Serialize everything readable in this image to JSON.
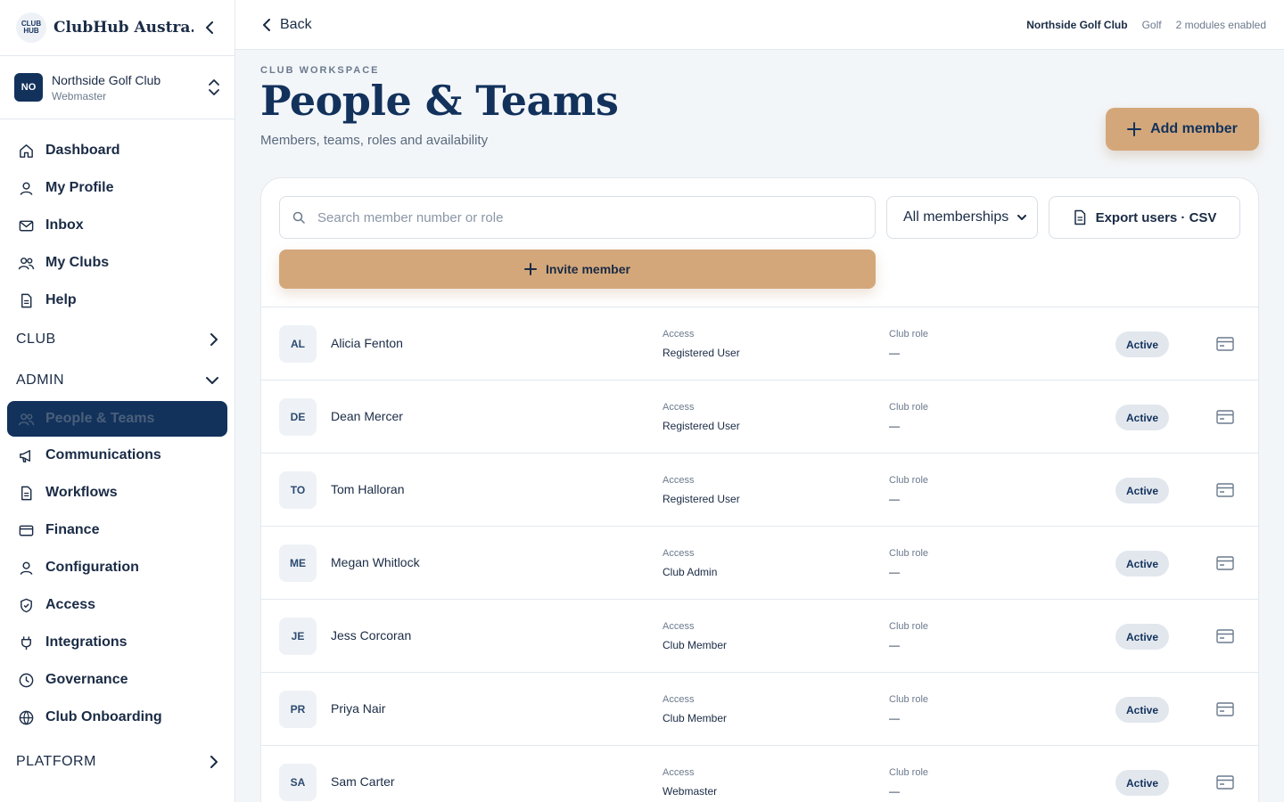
{
  "brand": {
    "title": "ClubHub Austra...",
    "logo_text": "CLUB HUB"
  },
  "club": {
    "badge": "NO",
    "name": "Northside Golf Club",
    "role": "Webmaster"
  },
  "nav": {
    "items": [
      {
        "label": "Dashboard",
        "icon": "home-icon"
      },
      {
        "label": "My Profile",
        "icon": "user-icon"
      },
      {
        "label": "Inbox",
        "icon": "mail-icon"
      },
      {
        "label": "My Clubs",
        "icon": "users-icon"
      },
      {
        "label": "Help",
        "icon": "document-icon"
      }
    ],
    "sections": {
      "club": "CLUB",
      "admin": "ADMIN",
      "platform": "PLATFORM"
    },
    "admin_items": [
      {
        "label": "People & Teams",
        "icon": "users-icon",
        "active": true
      },
      {
        "label": "Communications",
        "icon": "megaphone-icon"
      },
      {
        "label": "Workflows",
        "icon": "document-icon"
      },
      {
        "label": "Finance",
        "icon": "card-icon"
      },
      {
        "label": "Configuration",
        "icon": "user-icon"
      },
      {
        "label": "Access",
        "icon": "shield-icon"
      },
      {
        "label": "Integrations",
        "icon": "plug-icon"
      },
      {
        "label": "Governance",
        "icon": "clock-icon"
      },
      {
        "label": "Club Onboarding",
        "icon": "globe-icon"
      }
    ]
  },
  "topbar": {
    "back_label": "Back",
    "club_name": "Northside Golf Club",
    "sport": "Golf",
    "modules": "2 modules enabled"
  },
  "header": {
    "eyebrow": "CLUB WORKSPACE",
    "title": "People & Teams",
    "subtitle": "Members, teams, roles and availability",
    "add_member_label": "Add member"
  },
  "toolbar": {
    "search_placeholder": "Search member number or role",
    "membership_filter": "All memberships",
    "export_label": "Export users · CSV",
    "invite_label": "Invite member"
  },
  "columns": {
    "access": "Access",
    "club_role": "Club role"
  },
  "members": [
    {
      "initials": "AL",
      "name": "Alicia Fenton",
      "access": "Registered User",
      "club_role": "—",
      "status": "Active"
    },
    {
      "initials": "DE",
      "name": "Dean Mercer",
      "access": "Registered User",
      "club_role": "—",
      "status": "Active"
    },
    {
      "initials": "TO",
      "name": "Tom Halloran",
      "access": "Registered User",
      "club_role": "—",
      "status": "Active"
    },
    {
      "initials": "ME",
      "name": "Megan Whitlock",
      "access": "Club Admin",
      "club_role": "—",
      "status": "Active"
    },
    {
      "initials": "JE",
      "name": "Jess Corcoran",
      "access": "Club Member",
      "club_role": "—",
      "status": "Active"
    },
    {
      "initials": "PR",
      "name": "Priya Nair",
      "access": "Club Member",
      "club_role": "—",
      "status": "Active"
    },
    {
      "initials": "SA",
      "name": "Sam Carter",
      "access": "Webmaster",
      "club_role": "—",
      "status": "Active"
    }
  ],
  "colors": {
    "navy": "#12325c",
    "accent": "#d4a77a",
    "bg": "#f3f6f9"
  }
}
